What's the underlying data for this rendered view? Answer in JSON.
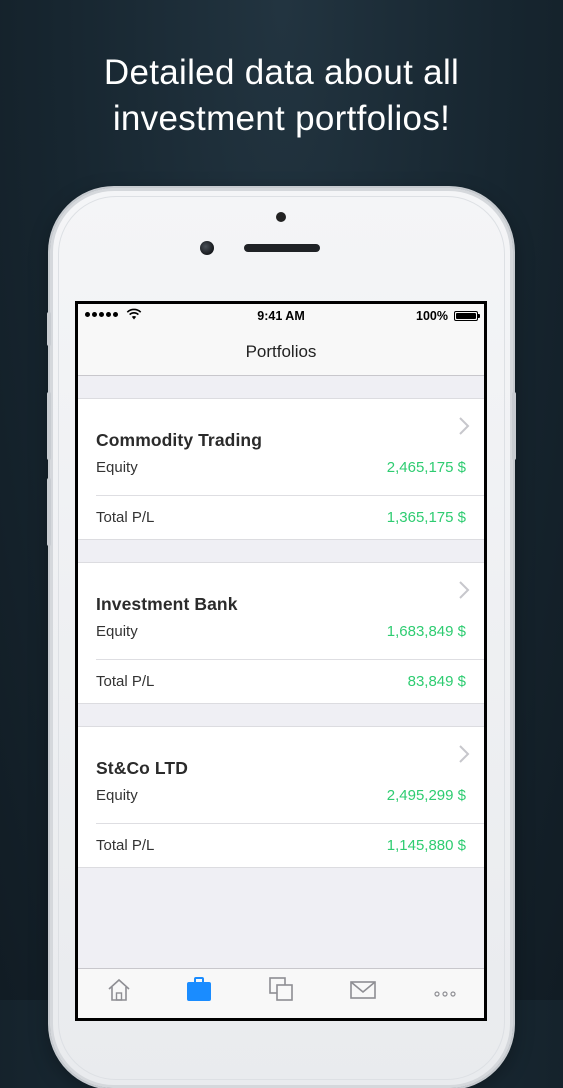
{
  "promo": {
    "line1": "Detailed data about all",
    "line2": "investment portfolios!"
  },
  "status_bar": {
    "time": "9:41 AM",
    "battery": "100%"
  },
  "nav": {
    "title": "Portfolios"
  },
  "portfolios": [
    {
      "name": "Commodity Trading",
      "equity_label": "Equity",
      "equity": "2,465,175 $",
      "pl_label": "Total P/L",
      "pl": "1,365,175 $"
    },
    {
      "name": "Investment Bank",
      "equity_label": "Equity",
      "equity": "1,683,849 $",
      "pl_label": "Total P/L",
      "pl": "83,849 $"
    },
    {
      "name": "St&Co LTD",
      "equity_label": "Equity",
      "equity": "2,495,299 $",
      "pl_label": "Total P/L",
      "pl": "1,145,880 $"
    }
  ],
  "tabs": [
    {
      "icon": "home-icon",
      "active": false
    },
    {
      "icon": "briefcase-icon",
      "active": true
    },
    {
      "icon": "copy-icon",
      "active": false
    },
    {
      "icon": "mail-icon",
      "active": false
    },
    {
      "icon": "more-icon",
      "active": false
    }
  ],
  "colors": {
    "positive": "#2ecc71",
    "accent": "#1a8cff",
    "background": "#172630"
  }
}
